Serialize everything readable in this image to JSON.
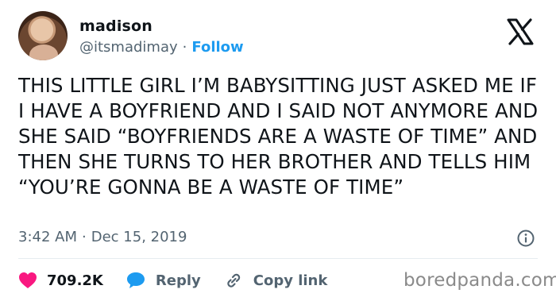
{
  "author": {
    "name": "madison",
    "handle": "@itsmadimay",
    "separator": "·",
    "follow_label": "Follow"
  },
  "icons": {
    "platform_logo": "x-logo-icon",
    "info": "info-circle-icon",
    "like": "heart-icon",
    "reply": "chat-bubble-icon",
    "copy_link": "link-icon"
  },
  "tweet": {
    "text": "THIS LITTLE GIRL I’M BABYSITTING JUST ASKED ME IF I HAVE A BOYFRIEND AND I SAID NOT ANYMORE AND SHE SAID “BOYFRIENDS ARE A WASTE OF TIME” AND THEN SHE TURNS TO HER BROTHER AND TELLS HIM “YOU’RE GONNA BE A WASTE OF TIME”",
    "time": "3:42 AM",
    "separator": "·",
    "date": "Dec 15, 2019"
  },
  "actions": {
    "likes_count": "709.2K",
    "reply_label": "Reply",
    "copy_link_label": "Copy link"
  },
  "watermark": "boredpanda.com",
  "colors": {
    "accent": "#1d9bf0",
    "heart": "#f91880",
    "text": "#0f1419",
    "muted": "#536471"
  }
}
